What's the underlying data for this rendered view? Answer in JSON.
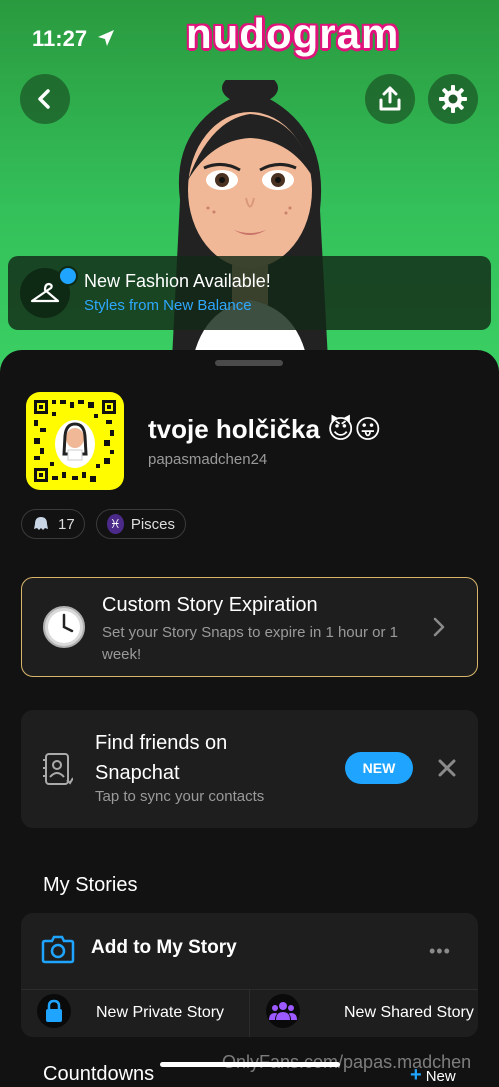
{
  "status_bar": {
    "time": "11:27"
  },
  "watermark_top": "nudogram",
  "fashion_banner": {
    "title": "New Fashion Available!",
    "subtitle": "Styles from New Balance"
  },
  "profile": {
    "display_name": "tvoje holčička 😈😛",
    "username": "papasmadchen24",
    "snapscore": "17",
    "zodiac": "Pisces",
    "zodiac_symbol": "♓"
  },
  "story_expiration": {
    "title": "Custom Story Expiration",
    "subtitle": "Set your Story Snaps to expire in 1 hour or 1 week!"
  },
  "find_friends": {
    "title": "Find friends on Snapchat",
    "subtitle": "Tap to sync your contacts",
    "badge": "NEW"
  },
  "my_stories": {
    "heading": "My Stories",
    "add_label": "Add to My Story",
    "private_label": "New Private Story",
    "shared_label": "New Shared Story"
  },
  "countdowns": {
    "heading": "Countdowns",
    "new_label": "New"
  },
  "watermark_bottom": "OnlyFans.com/papas.madchen",
  "colors": {
    "accent_blue": "#1fa5ff",
    "snap_yellow": "#fffc00",
    "hero_green": "#34c05a",
    "gold_border": "#d9b56c"
  }
}
